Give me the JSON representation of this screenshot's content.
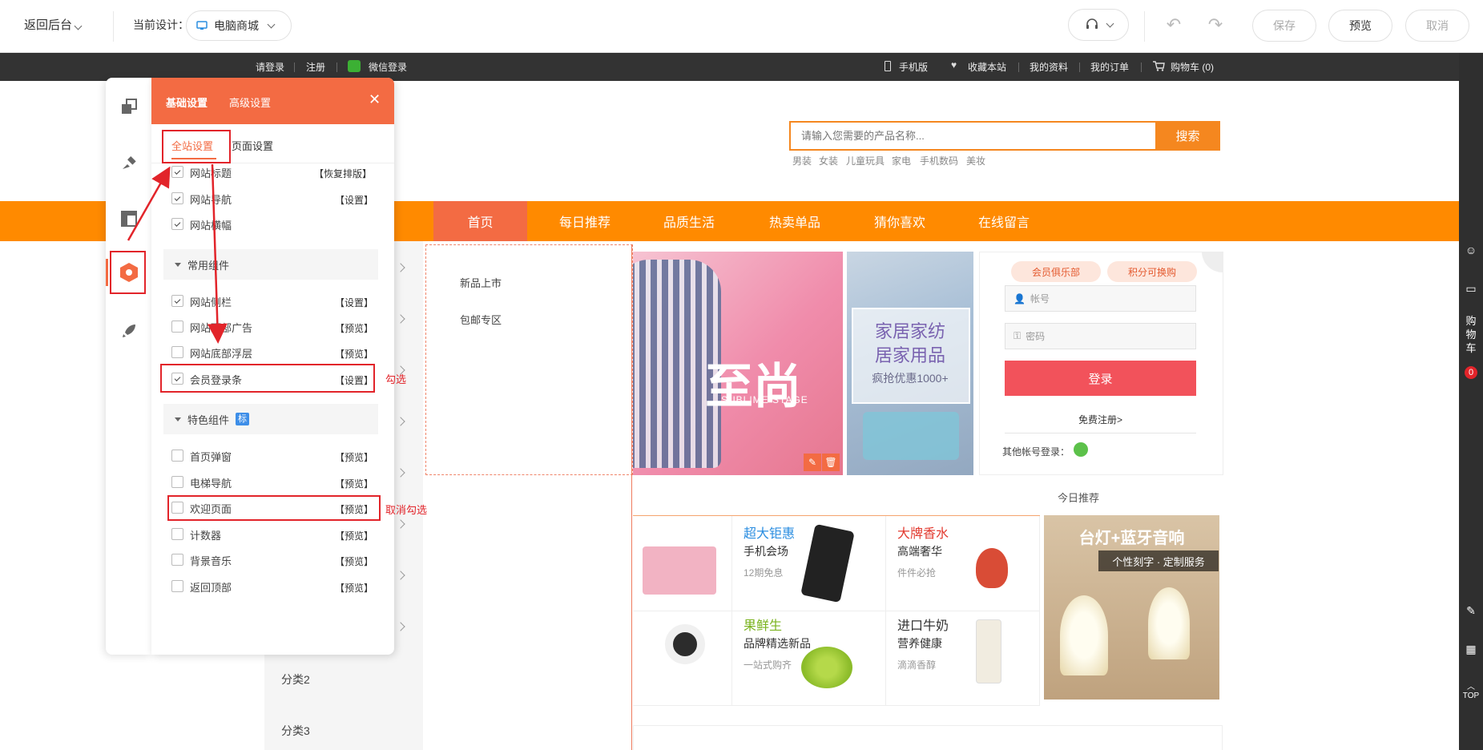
{
  "editor": {
    "back_label": "返回后台",
    "current_design_label": "当前设计：",
    "device_label": "电脑商城",
    "save_label": "保存",
    "preview_label": "预览",
    "cancel_label": "取消"
  },
  "topbar": {
    "login": "请登录",
    "register": "注册",
    "wechat_login": "微信登录",
    "mobile": "手机版",
    "favorite": "收藏本站",
    "profile": "我的资料",
    "orders": "我的订单",
    "cart": "购物车 (0)"
  },
  "search": {
    "placeholder": "请输入您需要的产品名称...",
    "button": "搜索",
    "hotwords": [
      "男装",
      "女装",
      "儿童玩具",
      "家电",
      "手机数码",
      "美妆"
    ]
  },
  "nav": {
    "items": [
      "首页",
      "每日推荐",
      "品质生活",
      "热卖单品",
      "猜你喜欢",
      "在线留言"
    ]
  },
  "categories": [
    "分类2",
    "分类3"
  ],
  "dropdown": [
    "新品上市",
    "包邮专区"
  ],
  "banner_fashion": {
    "title": "至尚",
    "subtitle": "SUBLIME STAGE"
  },
  "banner_home": {
    "line1": "家居家纺",
    "line2": "居家用品",
    "line3": "疯抢优惠1000+"
  },
  "member": {
    "club": "会员俱乐部",
    "points": "积分可换购",
    "account_placeholder": "帐号",
    "password_placeholder": "密码",
    "login_button": "登录",
    "free_register": "免费注册>",
    "other_login": "其他帐号登录："
  },
  "today": {
    "title": "今日推荐",
    "products": [
      {
        "title": "超大钜惠",
        "sub": "手机会场",
        "note": "12期免息",
        "color": "#2a8de0"
      },
      {
        "title": "大牌香水",
        "sub": "高端奢华",
        "note": "件件必抢",
        "color": "#e23a2f"
      },
      {
        "title": "果鲜生",
        "sub": "品牌精选新品",
        "note": "一站式购齐",
        "color": "#7ab31e"
      },
      {
        "title": "进口牛奶",
        "sub": "营养健康",
        "note": "滴滴香醇",
        "color": "#333333"
      }
    ],
    "lamp_title": "台灯+蓝牙音响",
    "lamp_sub": "个性刻字 · 定制服务"
  },
  "rail": {
    "cart_label": [
      "购",
      "物",
      "车"
    ],
    "cart_count": "0",
    "top": "TOP"
  },
  "panel": {
    "tabs": [
      "基础设置",
      "高级设置"
    ],
    "subtabs": [
      "全站设置",
      "页面设置"
    ],
    "rows_top": [
      {
        "label": "网站标题",
        "action": "【恢复排版】",
        "checked": true
      },
      {
        "label": "网站导航",
        "action": "【设置】",
        "checked": true
      },
      {
        "label": "网站横幅",
        "action": "",
        "checked": true
      }
    ],
    "group_common": "常用组件",
    "rows_common": [
      {
        "label": "网站侧栏",
        "action": "【设置】",
        "checked": true
      },
      {
        "label": "网站顶部广告",
        "action": "【预览】",
        "checked": false
      },
      {
        "label": "网站底部浮层",
        "action": "【预览】",
        "checked": false
      },
      {
        "label": "会员登录条",
        "action": "【设置】",
        "checked": true
      }
    ],
    "group_special": "特色组件",
    "group_special_badge": "标",
    "rows_special": [
      {
        "label": "首页弹窗",
        "action": "【预览】",
        "checked": false
      },
      {
        "label": "电梯导航",
        "action": "【预览】",
        "checked": false
      },
      {
        "label": "欢迎页面",
        "action": "【预览】",
        "checked": false
      },
      {
        "label": "计数器",
        "action": "【预览】",
        "checked": false
      },
      {
        "label": "背景音乐",
        "action": "【预览】",
        "checked": false
      },
      {
        "label": "返回顶部",
        "action": "【预览】",
        "checked": false
      }
    ]
  },
  "annotations": {
    "check": "勾选",
    "uncheck": "取消勾选"
  },
  "colors": {
    "accent": "#f36b43",
    "nav": "#ff8a00",
    "search": "#f5871f",
    "annotation_red": "#e2242a"
  }
}
